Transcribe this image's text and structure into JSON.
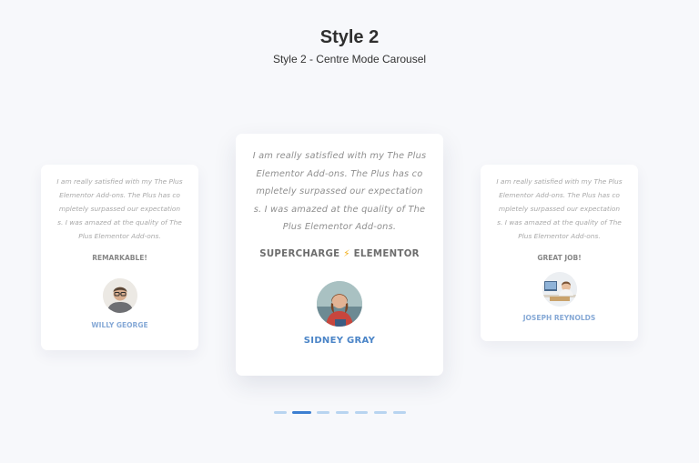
{
  "header": {
    "title": "Style 2",
    "subtitle": "Style 2 - Centre Mode Carousel"
  },
  "testimonials": [
    {
      "quote": "I am really satisfied with my The Plus Elementor Add-ons. The Plus has co mpletely surpassed our expectation s. I was amazed at the quality of The Plus Elementor Add-ons.",
      "quote_lines": [
        "I am really satisfied with my The Plus",
        "Elementor Add-ons. The Plus has co",
        "mpletely surpassed our expectation",
        "s. I was amazed at the quality of The",
        "Plus Elementor Add-ons."
      ],
      "tag": "REMARKABLE!",
      "name": "WILLY GEORGE",
      "avatar_icon": "person-glasses-avatar"
    },
    {
      "quote": "I am really satisfied with my The Plus Elementor Add-ons. The Plus has co mpletely surpassed our expectation s. I was amazed at the quality of The Plus Elementor Add-ons.",
      "quote_lines": [
        "I am really satisfied with my The Plus",
        "Elementor Add-ons. The Plus has co",
        "mpletely surpassed our expectation",
        "s. I was amazed at the quality of The",
        "Plus Elementor Add-ons."
      ],
      "tag_left": "SUPERCHARGE",
      "tag_icon": "⚡",
      "tag_right": "ELEMENTOR",
      "name": "SIDNEY GRAY",
      "avatar_icon": "woman-red-shirt-avatar"
    },
    {
      "quote": "I am really satisfied with my The Plus Elementor Add-ons. The Plus has co mpletely surpassed our expectation s. I was amazed at the quality of The Plus Elementor Add-ons.",
      "quote_lines": [
        "I am really satisfied with my The Plus",
        "Elementor Add-ons. The Plus has co",
        "mpletely surpassed our expectation",
        "s. I was amazed at the quality of The",
        "Plus Elementor Add-ons."
      ],
      "tag": "GREAT JOB!",
      "name": "JOSEPH REYNOLDS",
      "avatar_icon": "person-at-desk-avatar"
    }
  ],
  "pagination": {
    "count": 7,
    "active_index": 1
  },
  "colors": {
    "accent": "#3d7fd1",
    "name_blue": "#4a84c7",
    "dot_inactive": "#b8d4f0",
    "bolt": "#f2b01e"
  }
}
